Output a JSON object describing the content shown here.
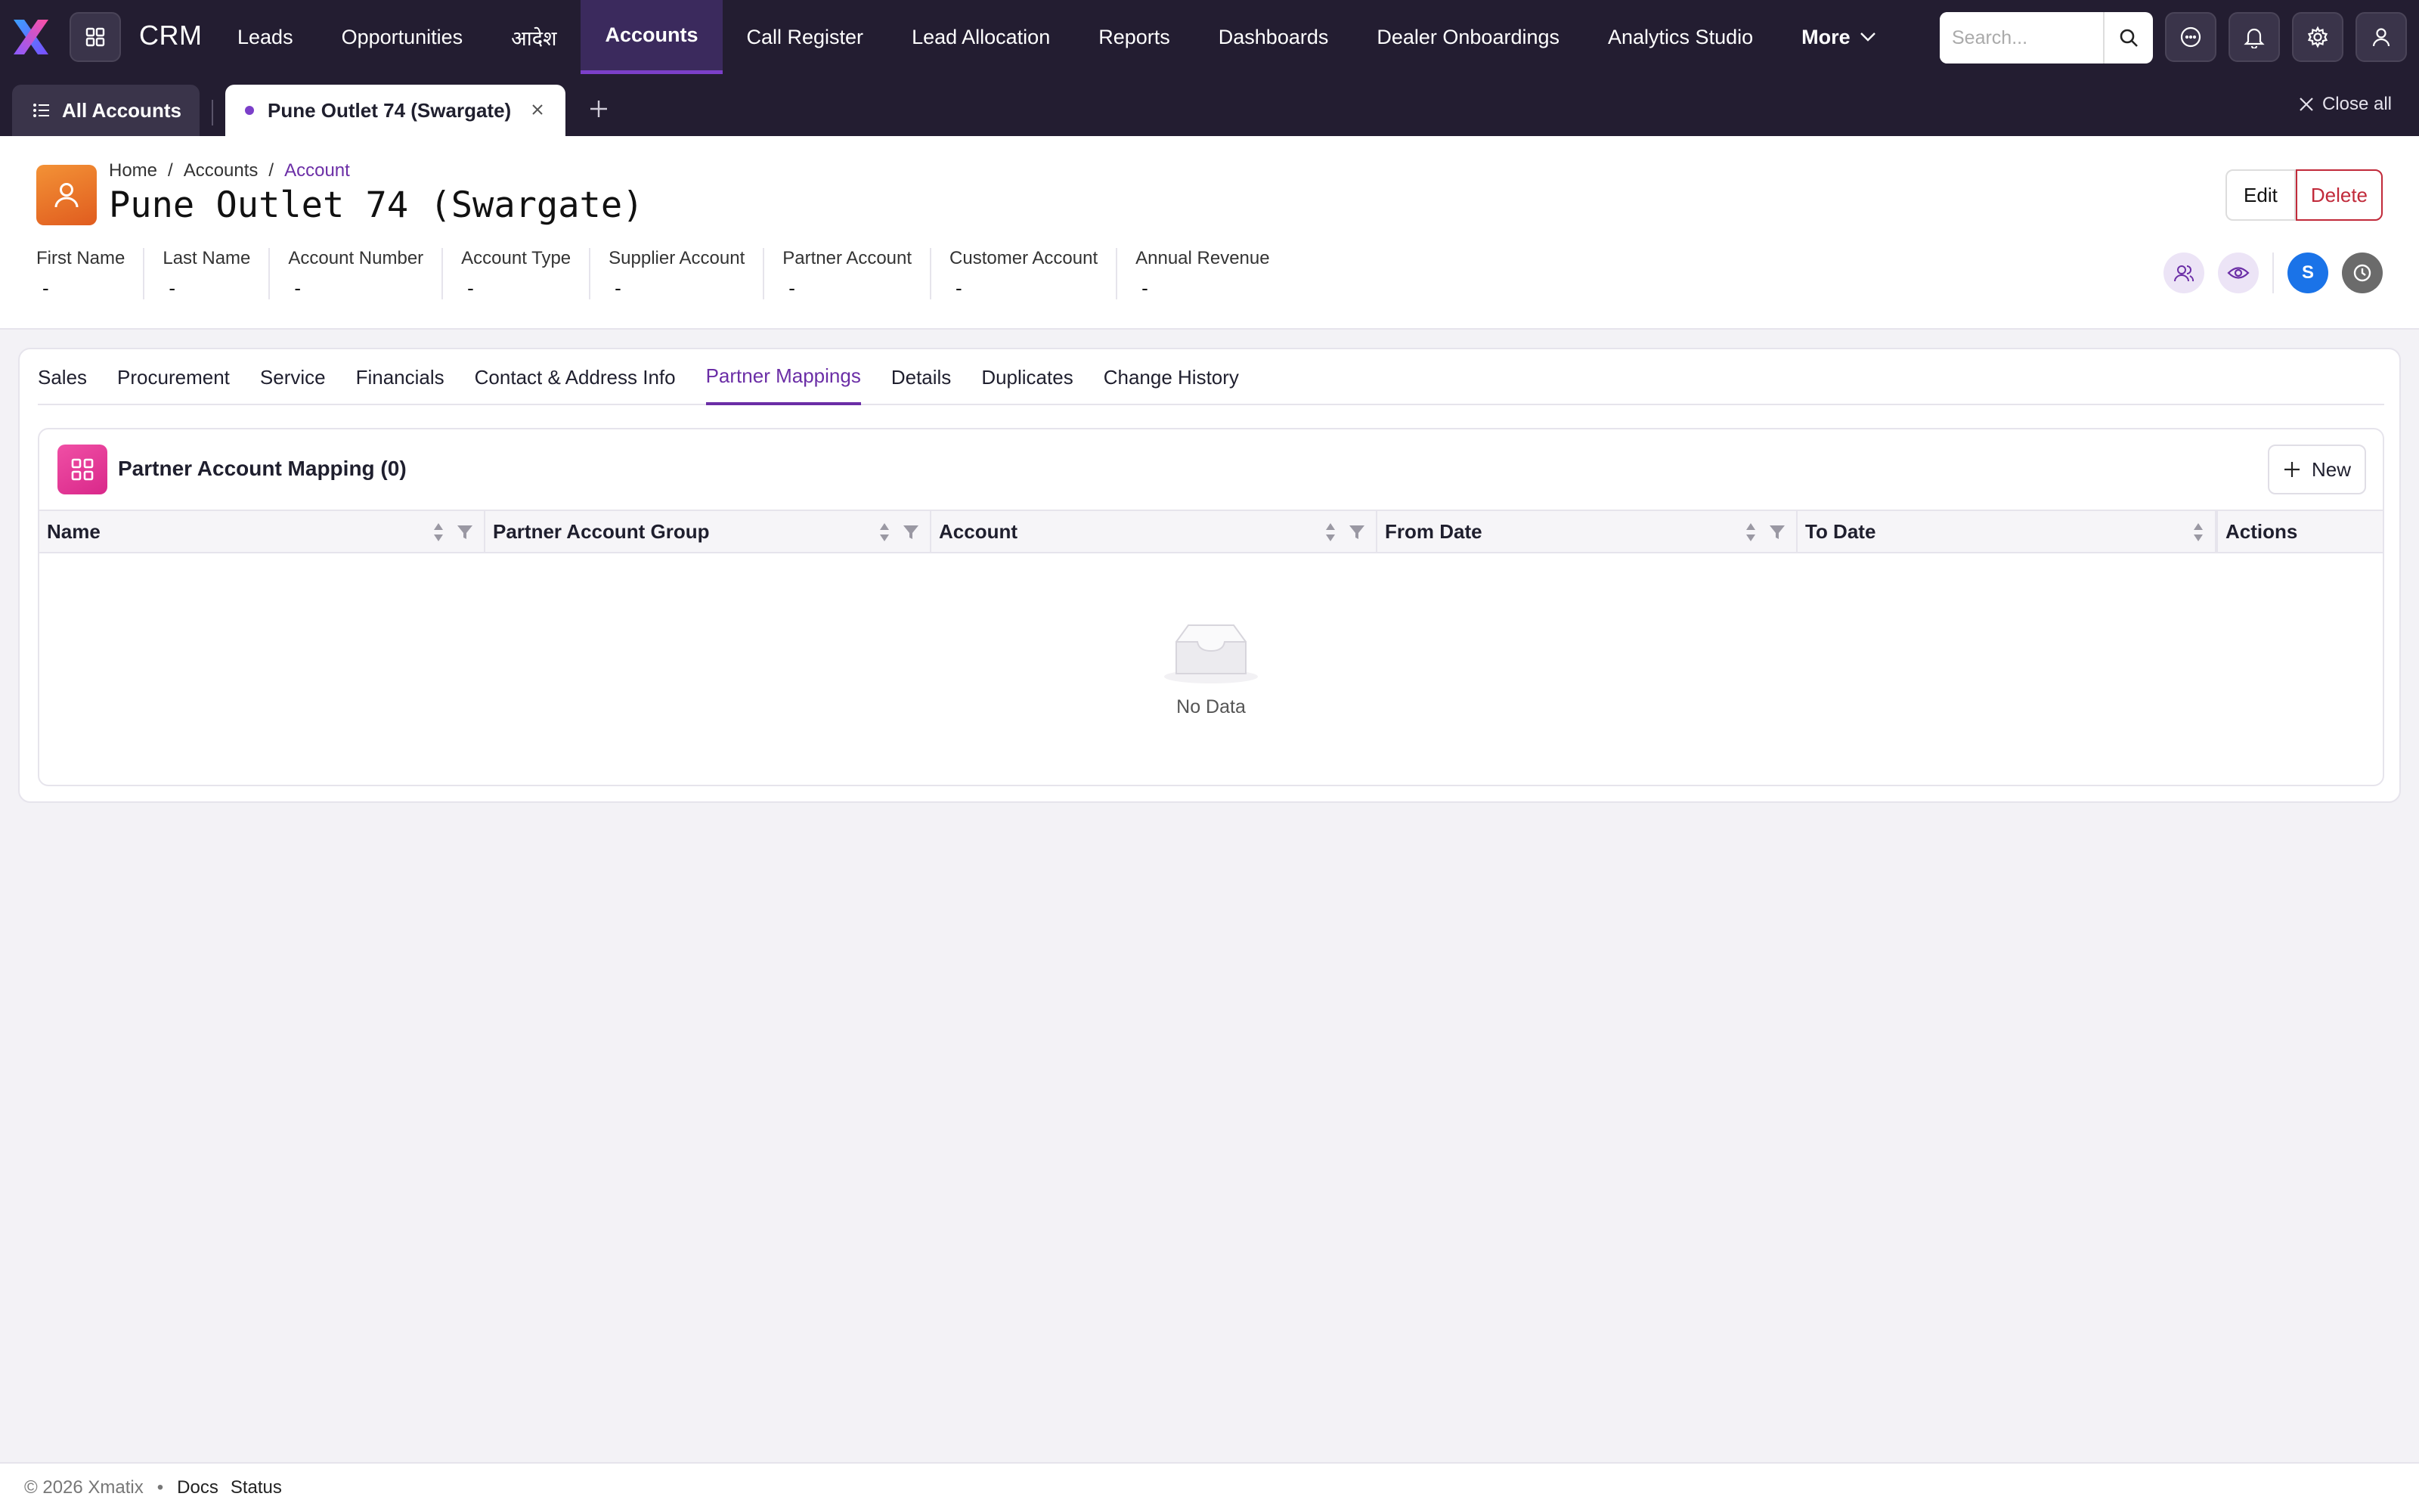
{
  "app": {
    "name": "CRM"
  },
  "nav": {
    "items": [
      {
        "label": "Leads"
      },
      {
        "label": "Opportunities"
      },
      {
        "label": "आदेश"
      },
      {
        "label": "Accounts",
        "active": true
      },
      {
        "label": "Call Register"
      },
      {
        "label": "Lead Allocation"
      },
      {
        "label": "Reports"
      },
      {
        "label": "Dashboards"
      },
      {
        "label": "Dealer Onboardings"
      },
      {
        "label": "Analytics Studio"
      }
    ],
    "more_label": "More",
    "search_placeholder": "Search..."
  },
  "tabs": {
    "all_label": "All Accounts",
    "open_doc_label": "Pune Outlet 74 (Swargate)",
    "close_all_label": "Close all"
  },
  "header": {
    "breadcrumb": [
      "Home",
      "Accounts",
      "Account"
    ],
    "title": "Pune Outlet 74 (Swargate)",
    "edit_label": "Edit",
    "delete_label": "Delete",
    "fields": [
      {
        "label": "First Name",
        "value": "-"
      },
      {
        "label": "Last Name",
        "value": "-"
      },
      {
        "label": "Account Number",
        "value": "-"
      },
      {
        "label": "Account Type",
        "value": "-"
      },
      {
        "label": "Supplier Account",
        "value": "-"
      },
      {
        "label": "Partner Account",
        "value": "-"
      },
      {
        "label": "Customer Account",
        "value": "-"
      },
      {
        "label": "Annual Revenue",
        "value": "-"
      }
    ],
    "user_initial": "S"
  },
  "subtabs": [
    {
      "label": "Sales"
    },
    {
      "label": "Procurement"
    },
    {
      "label": "Service"
    },
    {
      "label": "Financials"
    },
    {
      "label": "Contact & Address Info"
    },
    {
      "label": "Partner Mappings",
      "active": true
    },
    {
      "label": "Details"
    },
    {
      "label": "Duplicates"
    },
    {
      "label": "Change History"
    }
  ],
  "mapping": {
    "title": "Partner Account Mapping (0)",
    "new_label": "New",
    "columns": [
      "Name",
      "Partner Account Group",
      "Account",
      "From Date",
      "To Date",
      "Actions"
    ],
    "empty_text": "No Data"
  },
  "footer": {
    "copyright": "© 2026 Xmatix",
    "links": [
      "Docs",
      "Status"
    ]
  },
  "colors": {
    "nav_bg": "#231d31",
    "accent": "#6b2ea6",
    "danger": "#c12a3a",
    "account_avatar": "#f07f2c",
    "mapping_icon": "#e83e99"
  }
}
